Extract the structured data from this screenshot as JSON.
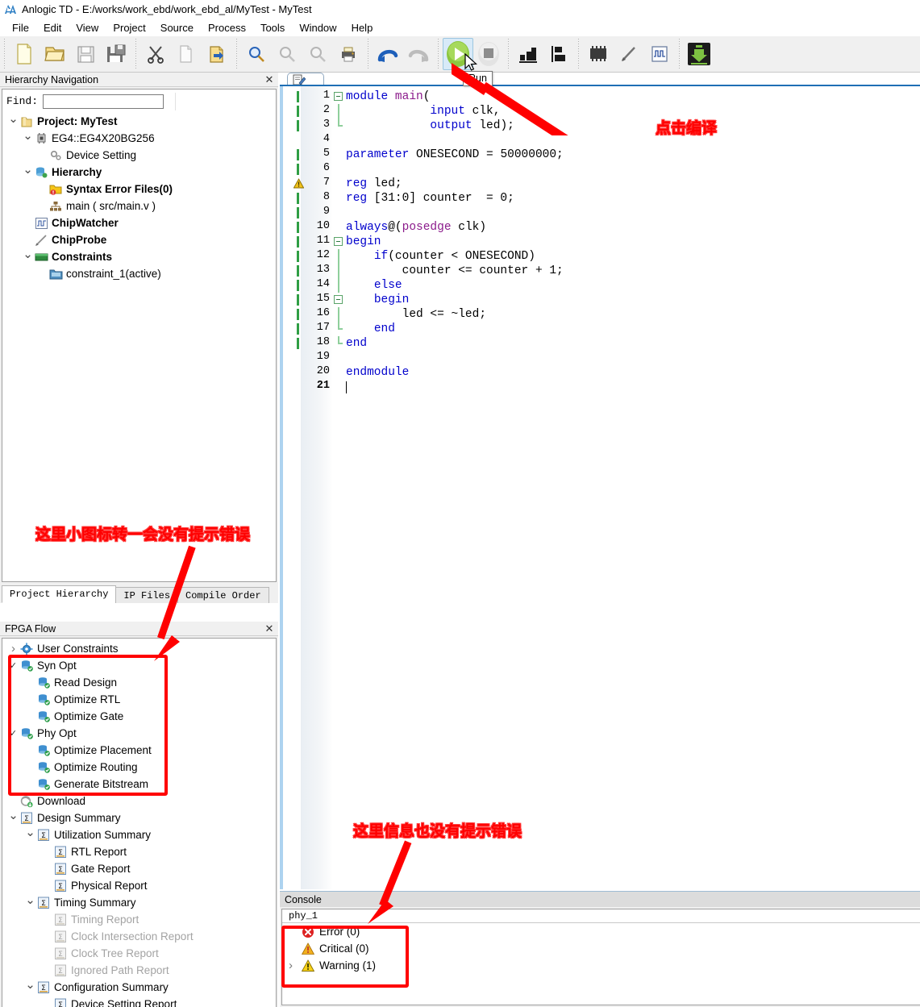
{
  "window": {
    "title": "Anlogic TD - E:/works/work_ebd/work_ebd_al/MyTest - MyTest",
    "logo_icon": "anlogic-logo-icon"
  },
  "menubar": {
    "items": [
      {
        "label": "File"
      },
      {
        "label": "Edit"
      },
      {
        "label": "View"
      },
      {
        "label": "Project"
      },
      {
        "label": "Source"
      },
      {
        "label": "Process"
      },
      {
        "label": "Tools"
      },
      {
        "label": "Window"
      },
      {
        "label": "Help"
      }
    ]
  },
  "toolbar": {
    "groups": [
      {
        "buttons": [
          {
            "name": "new-file-icon",
            "title": "New"
          },
          {
            "name": "open-folder-icon",
            "title": "Open"
          },
          {
            "name": "save-icon",
            "title": "Save"
          },
          {
            "name": "save-all-icon",
            "title": "Save All"
          }
        ]
      },
      {
        "buttons": [
          {
            "name": "cut-scissors-icon",
            "title": "Cut"
          },
          {
            "name": "copy-icon",
            "title": "Copy"
          },
          {
            "name": "paste-icon",
            "title": "Paste"
          }
        ]
      },
      {
        "buttons": [
          {
            "name": "search-icon",
            "title": "Find"
          },
          {
            "name": "undo-arrow-icon",
            "title": "Undo"
          },
          {
            "name": "redo-arrow-icon",
            "title": "Redo"
          },
          {
            "name": "print-icon",
            "title": "Print"
          }
        ]
      },
      {
        "buttons": [
          {
            "name": "undo-blue-icon",
            "title": "Undo"
          },
          {
            "name": "redo-gray-icon",
            "title": "Redo"
          }
        ]
      },
      {
        "buttons": [
          {
            "name": "run-play-icon",
            "title": "Run"
          },
          {
            "name": "stop-icon",
            "title": "Stop"
          }
        ]
      },
      {
        "buttons": [
          {
            "name": "report-bar-icon",
            "title": "Reports"
          },
          {
            "name": "floorplan-icon",
            "title": "Floorplan"
          }
        ]
      },
      {
        "buttons": [
          {
            "name": "chip-icon",
            "title": "Device"
          },
          {
            "name": "probe-pen-icon",
            "title": "ChipProbe"
          },
          {
            "name": "waveform-icon",
            "title": "ChipWatcher"
          }
        ]
      },
      {
        "buttons": [
          {
            "name": "download-icon",
            "title": "Download"
          }
        ]
      }
    ],
    "run_tooltip": "Run"
  },
  "hierarchy_panel": {
    "title": "Hierarchy Navigation",
    "close_label": "✕",
    "find_label": "Find:",
    "find_value": "",
    "find_placeholder": "",
    "tree": [
      {
        "label": "Project: MyTest",
        "indent": 0,
        "twisty": "down",
        "icon": "project-folder-icon",
        "bold": true,
        "dim": false
      },
      {
        "label": "EG4::EG4X20BG256",
        "indent": 1,
        "twisty": "down",
        "icon": "chip-small-icon",
        "bold": false,
        "dim": false
      },
      {
        "label": "Device Setting",
        "indent": 2,
        "twisty": "none",
        "icon": "gear-settings-icon",
        "bold": false,
        "dim": false
      },
      {
        "label": "Hierarchy",
        "indent": 1,
        "twisty": "down",
        "icon": "hierarchy-db-icon",
        "bold": true,
        "dim": false
      },
      {
        "label": "Syntax Error Files(0)",
        "indent": 2,
        "twisty": "none",
        "icon": "error-folder-icon",
        "bold": true,
        "dim": false
      },
      {
        "label": "main ( src/main.v )",
        "indent": 2,
        "twisty": "none",
        "icon": "module-tree-icon",
        "bold": false,
        "dim": false
      },
      {
        "label": "ChipWatcher",
        "indent": 1,
        "twisty": "none",
        "icon": "waveform-icon",
        "bold": true,
        "dim": false
      },
      {
        "label": "ChipProbe",
        "indent": 1,
        "twisty": "none",
        "icon": "probe-pen-icon",
        "bold": true,
        "dim": false
      },
      {
        "label": "Constraints",
        "indent": 1,
        "twisty": "down",
        "icon": "constraints-icon",
        "bold": true,
        "dim": false
      },
      {
        "label": "constraint_1(active)",
        "indent": 2,
        "twisty": "none",
        "icon": "constraint-file-icon",
        "bold": false,
        "dim": false
      }
    ],
    "tabs": [
      {
        "label": "Project Hierarchy",
        "selected": true
      },
      {
        "label": "IP Files",
        "selected": false
      },
      {
        "label": "Compile Order",
        "selected": false
      }
    ]
  },
  "flow_panel": {
    "title": "FPGA Flow",
    "close_label": "✕",
    "tree": [
      {
        "label": "User Constraints",
        "indent": 0,
        "twisty": "right",
        "icon": "gear-blue-icon",
        "dim": false
      },
      {
        "label": "Syn Opt",
        "indent": 0,
        "twisty": "tick",
        "icon": "process-ok-icon",
        "dim": false
      },
      {
        "label": "Read Design",
        "indent": 1,
        "twisty": "none",
        "icon": "process-ok-icon",
        "dim": false
      },
      {
        "label": "Optimize RTL",
        "indent": 1,
        "twisty": "none",
        "icon": "process-ok-icon",
        "dim": false
      },
      {
        "label": "Optimize Gate",
        "indent": 1,
        "twisty": "none",
        "icon": "process-ok-icon",
        "dim": false
      },
      {
        "label": "Phy Opt",
        "indent": 0,
        "twisty": "tick",
        "icon": "process-ok-icon",
        "dim": false
      },
      {
        "label": "Optimize Placement",
        "indent": 1,
        "twisty": "none",
        "icon": "process-ok-icon",
        "dim": false
      },
      {
        "label": "Optimize Routing",
        "indent": 1,
        "twisty": "none",
        "icon": "process-ok-icon",
        "dim": false
      },
      {
        "label": "Generate Bitstream",
        "indent": 1,
        "twisty": "none",
        "icon": "process-ok-icon",
        "dim": false
      },
      {
        "label": "Download",
        "indent": 0,
        "twisty": "none",
        "icon": "download-small-icon",
        "dim": false
      },
      {
        "label": "Design Summary",
        "indent": 0,
        "twisty": "down",
        "icon": "report-sigma-icon",
        "dim": false
      },
      {
        "label": "Utilization Summary",
        "indent": 1,
        "twisty": "down",
        "icon": "report-sigma-icon",
        "dim": false
      },
      {
        "label": "RTL Report",
        "indent": 2,
        "twisty": "none",
        "icon": "report-sigma-icon",
        "dim": false
      },
      {
        "label": "Gate Report",
        "indent": 2,
        "twisty": "none",
        "icon": "report-sigma-icon",
        "dim": false
      },
      {
        "label": "Physical Report",
        "indent": 2,
        "twisty": "none",
        "icon": "report-sigma-icon",
        "dim": false
      },
      {
        "label": "Timing Summary",
        "indent": 1,
        "twisty": "down",
        "icon": "report-sigma-icon",
        "dim": false
      },
      {
        "label": "Timing Report",
        "indent": 2,
        "twisty": "none",
        "icon": "report-sigma-gray-icon",
        "dim": true
      },
      {
        "label": "Clock Intersection Report",
        "indent": 2,
        "twisty": "none",
        "icon": "report-sigma-gray-icon",
        "dim": true
      },
      {
        "label": "Clock Tree Report",
        "indent": 2,
        "twisty": "none",
        "icon": "report-sigma-gray-icon",
        "dim": true
      },
      {
        "label": "Ignored Path Report",
        "indent": 2,
        "twisty": "none",
        "icon": "report-sigma-gray-icon",
        "dim": true
      },
      {
        "label": "Configuration Summary",
        "indent": 1,
        "twisty": "down",
        "icon": "report-sigma-icon",
        "dim": false
      },
      {
        "label": "Device Setting Report",
        "indent": 2,
        "twisty": "none",
        "icon": "report-sigma-icon",
        "dim": false
      }
    ]
  },
  "editor": {
    "tab_icon": "source-file-edit-icon",
    "lines": [
      {
        "n": "1",
        "text": "module main(",
        "marker": true,
        "warn": false,
        "fold": "open"
      },
      {
        "n": "2",
        "text": "            input clk,",
        "marker": true,
        "warn": false,
        "fold": "mid"
      },
      {
        "n": "3",
        "text": "            output led);",
        "marker": true,
        "warn": false,
        "fold": "end"
      },
      {
        "n": "4",
        "text": "",
        "marker": false,
        "warn": false,
        "fold": "none"
      },
      {
        "n": "5",
        "text": "parameter ONESECOND = 50000000;",
        "marker": true,
        "warn": false,
        "fold": "none"
      },
      {
        "n": "6",
        "text": "",
        "marker": true,
        "warn": false,
        "fold": "none"
      },
      {
        "n": "7",
        "text": "reg led;",
        "marker": false,
        "warn": true,
        "fold": "none"
      },
      {
        "n": "8",
        "text": "reg [31:0] counter  = 0;",
        "marker": true,
        "warn": false,
        "fold": "none"
      },
      {
        "n": "9",
        "text": "",
        "marker": true,
        "warn": false,
        "fold": "none"
      },
      {
        "n": "10",
        "text": "always@(posedge clk)",
        "marker": true,
        "warn": false,
        "fold": "none"
      },
      {
        "n": "11",
        "text": "begin",
        "marker": true,
        "warn": false,
        "fold": "open"
      },
      {
        "n": "12",
        "text": "    if(counter < ONESECOND)",
        "marker": true,
        "warn": false,
        "fold": "mid"
      },
      {
        "n": "13",
        "text": "        counter <= counter + 1;",
        "marker": true,
        "warn": false,
        "fold": "mid"
      },
      {
        "n": "14",
        "text": "    else",
        "marker": true,
        "warn": false,
        "fold": "mid"
      },
      {
        "n": "15",
        "text": "    begin",
        "marker": true,
        "warn": false,
        "fold": "open"
      },
      {
        "n": "16",
        "text": "        led <= ~led;",
        "marker": true,
        "warn": false,
        "fold": "mid"
      },
      {
        "n": "17",
        "text": "    end",
        "marker": true,
        "warn": false,
        "fold": "end"
      },
      {
        "n": "18",
        "text": "end",
        "marker": true,
        "warn": false,
        "fold": "end"
      },
      {
        "n": "19",
        "text": "",
        "marker": false,
        "warn": false,
        "fold": "none"
      },
      {
        "n": "20",
        "text": "endmodule",
        "marker": false,
        "warn": false,
        "fold": "none"
      },
      {
        "n": "21",
        "text": "",
        "marker": false,
        "warn": false,
        "fold": "none",
        "current": true
      }
    ]
  },
  "console": {
    "title": "Console",
    "tab_label": "phy_1",
    "messages": [
      {
        "label": "Error (0)",
        "icon": "error-circle-icon",
        "twisty": false
      },
      {
        "label": "Critical (0)",
        "icon": "critical-warn-icon",
        "twisty": false
      },
      {
        "label": "Warning (1)",
        "icon": "warning-triangle-icon",
        "twisty": true
      }
    ]
  },
  "annotations": {
    "compile_note": "点击编译",
    "icon_note": "这里小图标转一会没有提示错误",
    "console_note": "这里信息也没有提示错误"
  },
  "colors": {
    "annotation_red": "#ff0000",
    "accent_blue": "#1f6fb5",
    "keyword_blue": "#0000cc",
    "keyword_purple": "#8b1a8b",
    "toolbar_bg": "#f0f0f0"
  }
}
